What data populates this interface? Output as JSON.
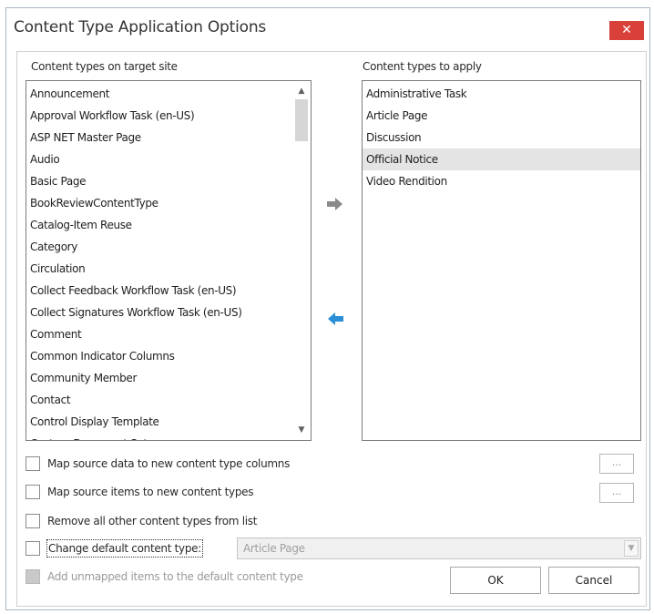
{
  "window": {
    "title": "Content Type Application Options",
    "close_glyph": "✕"
  },
  "source_list": {
    "label": "Content types on target site",
    "items": [
      "Announcement",
      "Approval Workflow Task (en-US)",
      "ASP NET Master Page",
      "Audio",
      "Basic Page",
      "BookReviewContentType",
      "Catalog-Item Reuse",
      "Category",
      "Circulation",
      "Collect Feedback Workflow Task (en-US)",
      "Collect Signatures Workflow Task (en-US)",
      "Comment",
      "Common Indicator Columns",
      "Community Member",
      "Contact",
      "Control Display Template",
      "Custom Document Set"
    ],
    "scroll_up_glyph": "▲",
    "scroll_down_glyph": "▼"
  },
  "target_list": {
    "label": "Content types to apply",
    "items": [
      "Administrative Task",
      "Article Page",
      "Discussion",
      "Official Notice",
      "Video Rendition"
    ],
    "selected_item": "Official Notice"
  },
  "transfer": {
    "add_icon": "arrow-right-icon",
    "remove_icon": "arrow-left-icon",
    "add_color": "#8a8a8a",
    "remove_color": "#2a8fd6"
  },
  "options": {
    "map_columns_label": "Map source data to new content type columns",
    "map_items_label": "Map source items to new content types",
    "remove_others_label": "Remove all other content types from list",
    "change_default_label": "Change default content type:",
    "default_type_value": "Article Page",
    "add_unmapped_label": "Add unmapped items to the default content type",
    "ellipsis": "..."
  },
  "buttons": {
    "ok": "OK",
    "cancel": "Cancel"
  },
  "colors": {
    "close_button": "#d9403a",
    "selection": "#e4e4e4"
  }
}
